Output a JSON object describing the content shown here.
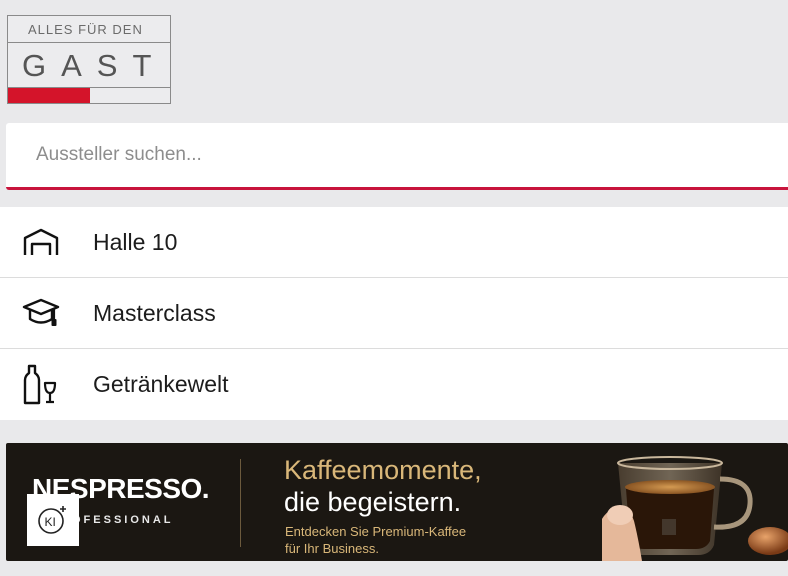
{
  "logo": {
    "line1": "ALLES FÜR DEN",
    "line2": "GAST",
    "accent_color": "#d4142a"
  },
  "search": {
    "placeholder": "Aussteller suchen...",
    "value": "",
    "accent_color": "#c8143c"
  },
  "menu": {
    "items": [
      {
        "label": "Halle 10",
        "icon": "hall-icon"
      },
      {
        "label": "Masterclass",
        "icon": "graduation-cap-icon"
      },
      {
        "label": "Getränkewelt",
        "icon": "bottle-glass-icon"
      }
    ]
  },
  "banner": {
    "brand": "NESPRESSO.",
    "brand_sub": "OFESSIONAL",
    "headline_line1": "Kaffeemomente,",
    "headline_line2": "die begeistern.",
    "sub_line1": "Entdecken Sie Premium-Kaffee",
    "sub_line2": "für Ihr Business.",
    "badge": "KI"
  }
}
